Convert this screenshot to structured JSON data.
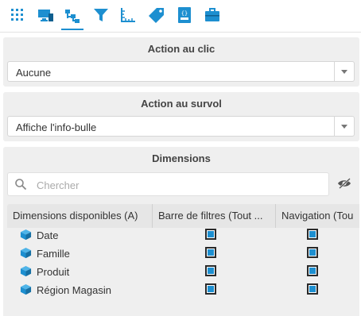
{
  "toolbar": {
    "icons": [
      "grid-icon",
      "monitor-icon",
      "hierarchy-icon",
      "filter-icon",
      "ruler-icon",
      "tag-icon",
      "json-file-icon",
      "toolbox-icon"
    ],
    "active_index": 2,
    "accent": "#1d8fd0"
  },
  "click_action": {
    "title": "Action au clic",
    "value": "Aucune"
  },
  "hover_action": {
    "title": "Action au survol",
    "value": "Affiche l'info-bulle"
  },
  "dimensions": {
    "title": "Dimensions",
    "search_placeholder": "Chercher",
    "columns": [
      "Dimensions disponibles (A)",
      "Barre de filtres (Tout ...",
      "Navigation (Tou"
    ],
    "rows": [
      {
        "name": "Date",
        "filter_bar": true,
        "navigation": true
      },
      {
        "name": "Famille",
        "filter_bar": true,
        "navigation": true
      },
      {
        "name": "Produit",
        "filter_bar": true,
        "navigation": true
      },
      {
        "name": "Région Magasin",
        "filter_bar": true,
        "navigation": true
      }
    ]
  }
}
